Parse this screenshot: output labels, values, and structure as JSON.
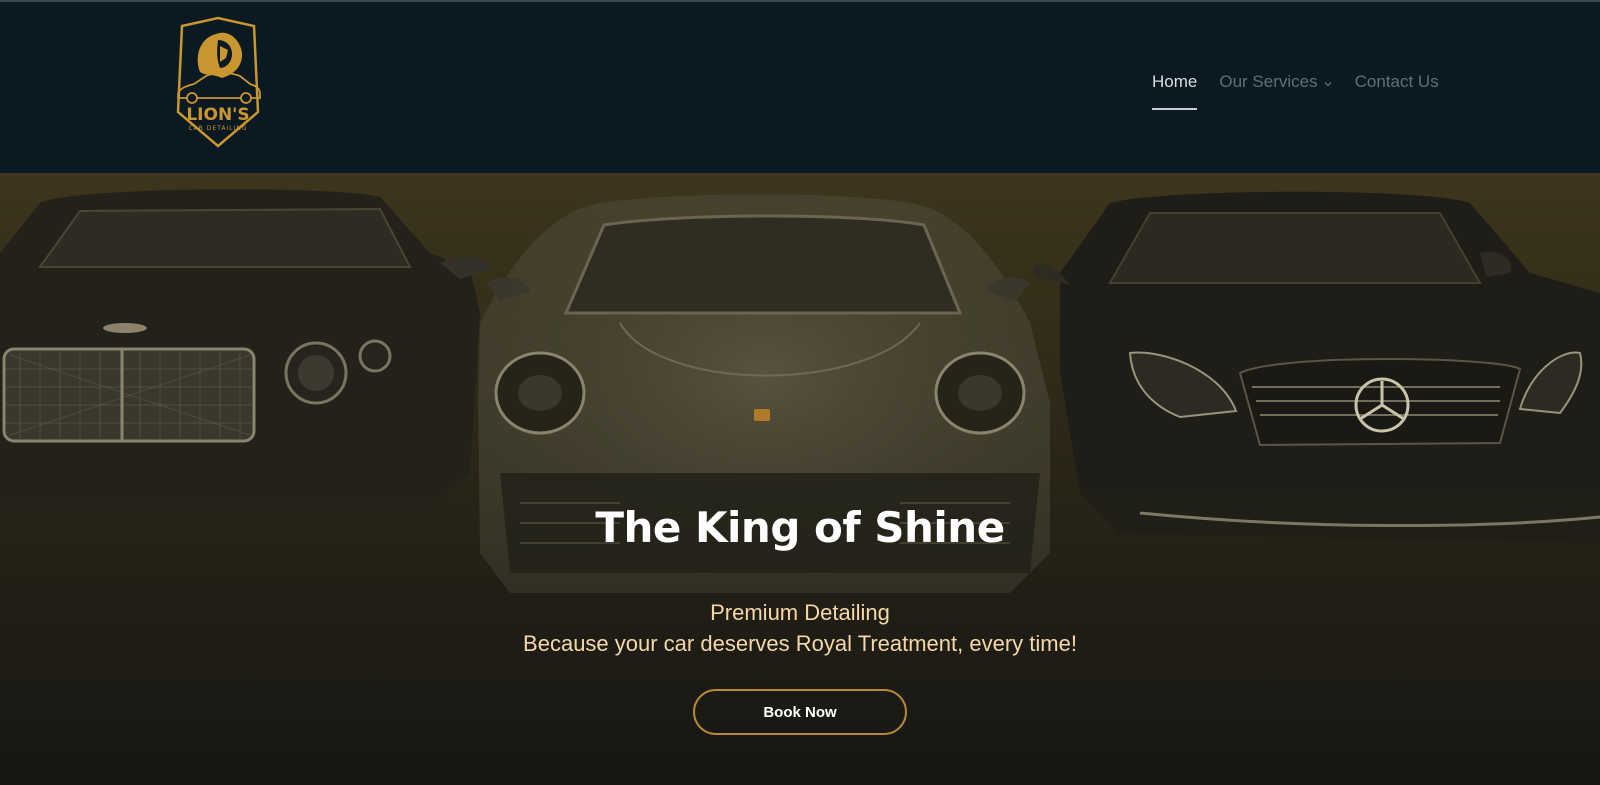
{
  "logo": {
    "name": "LION'S",
    "tagline": "CAR DETAILING"
  },
  "nav": {
    "items": [
      {
        "label": "Home",
        "active": true
      },
      {
        "label": "Our Services",
        "has_dropdown": true
      },
      {
        "label": "Contact Us"
      }
    ]
  },
  "hero": {
    "title": "The King of Shine",
    "subtitle": "Premium Detailing",
    "tagline": "Because your car deserves Royal Treatment, every time!",
    "cta_label": "Book Now"
  },
  "colors": {
    "header_bg": "#0b1a22",
    "gold": "#c9962f",
    "cta_border": "#b38a3a",
    "subtitle_text": "#f4d8a8"
  },
  "icons": {
    "logo": "lion-car-shield-logo",
    "dropdown": "chevron-down-icon"
  }
}
